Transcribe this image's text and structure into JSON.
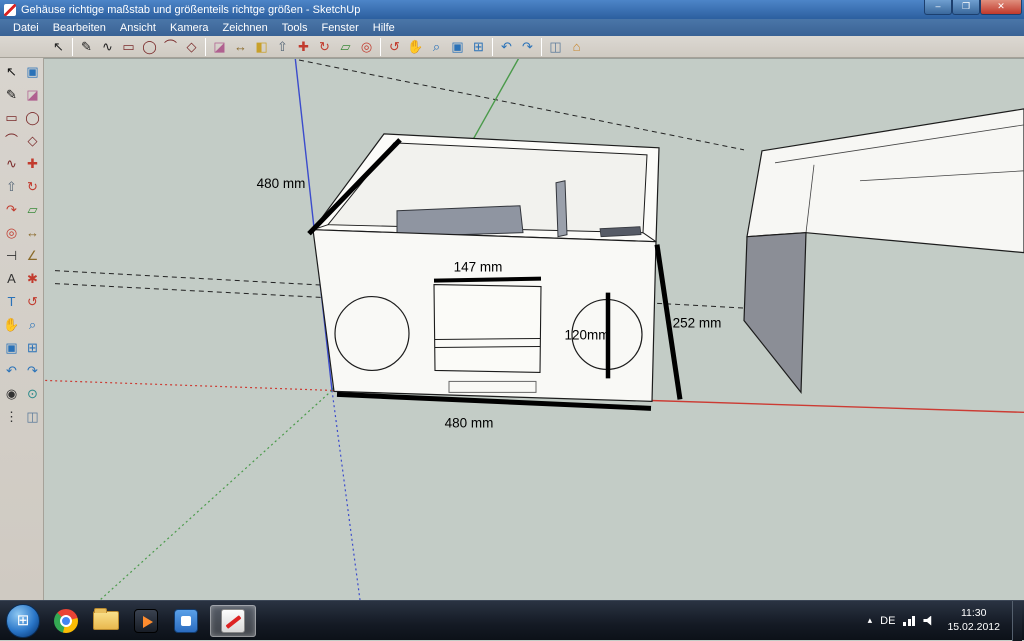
{
  "window": {
    "title": "Gehäuse richtige maßstab und größenteils richtge größen - SketchUp",
    "minimize": "–",
    "maximize": "❐",
    "close": "✕"
  },
  "menubar": {
    "items": [
      "Datei",
      "Bearbeiten",
      "Ansicht",
      "Kamera",
      "Zeichnen",
      "Tools",
      "Fenster",
      "Hilfe"
    ]
  },
  "toolbar": {
    "tools": [
      {
        "name": "select",
        "glyph": "↖",
        "color": "#222222"
      },
      {
        "name": "line",
        "glyph": "✎",
        "color": "#222222"
      },
      {
        "name": "freehand",
        "glyph": "∿",
        "color": "#222222"
      },
      {
        "name": "rectangle",
        "glyph": "▭",
        "color": "#7a2a2a"
      },
      {
        "name": "circle",
        "glyph": "◯",
        "color": "#7a2a2a"
      },
      {
        "name": "arc",
        "glyph": "⌒",
        "color": "#7a2a2a"
      },
      {
        "name": "polygon",
        "glyph": "◇",
        "color": "#7a2a2a"
      },
      {
        "name": "eraser",
        "glyph": "◪",
        "color": "#b06090"
      },
      {
        "name": "tape-measure",
        "glyph": "↔",
        "color": "#8a6a2a"
      },
      {
        "name": "paint-bucket",
        "glyph": "◧",
        "color": "#c8a02a"
      },
      {
        "name": "push-pull",
        "glyph": "⇧",
        "color": "#556677"
      },
      {
        "name": "move",
        "glyph": "✚",
        "color": "#c23b2e"
      },
      {
        "name": "rotate",
        "glyph": "↻",
        "color": "#c23b2e"
      },
      {
        "name": "scale",
        "glyph": "▱",
        "color": "#3a8a3a"
      },
      {
        "name": "offset",
        "glyph": "◎",
        "color": "#c23b2e"
      },
      {
        "name": "orbit",
        "glyph": "↺",
        "color": "#c23b2e"
      },
      {
        "name": "pan",
        "glyph": "✋",
        "color": "#b8863a"
      },
      {
        "name": "zoom",
        "glyph": "⌕",
        "color": "#2a72b8"
      },
      {
        "name": "zoom-window",
        "glyph": "▣",
        "color": "#2a72b8"
      },
      {
        "name": "zoom-extents",
        "glyph": "⊞",
        "color": "#2a72b8"
      },
      {
        "name": "previous",
        "glyph": "↶",
        "color": "#2a72b8"
      },
      {
        "name": "next",
        "glyph": "↷",
        "color": "#2a72b8"
      },
      {
        "name": "section-plane",
        "glyph": "◫",
        "color": "#5a7a9a"
      },
      {
        "name": "get-models",
        "glyph": "⌂",
        "color": "#c8862a"
      }
    ]
  },
  "palette": {
    "tools": [
      {
        "name": "select",
        "glyph": "↖",
        "color": "#111111"
      },
      {
        "name": "make-component",
        "glyph": "▣",
        "color": "#2a72b8"
      },
      {
        "name": "line",
        "glyph": "✎",
        "color": "#111111"
      },
      {
        "name": "eraser",
        "glyph": "◪",
        "color": "#b06090"
      },
      {
        "name": "rectangle",
        "glyph": "▭",
        "color": "#7a2a2a"
      },
      {
        "name": "circle",
        "glyph": "◯",
        "color": "#7a2a2a"
      },
      {
        "name": "arc",
        "glyph": "⌒",
        "color": "#7a2a2a"
      },
      {
        "name": "polygon",
        "glyph": "◇",
        "color": "#7a2a2a"
      },
      {
        "name": "freehand",
        "glyph": "∿",
        "color": "#7a2a2a"
      },
      {
        "name": "move",
        "glyph": "✚",
        "color": "#c23b2e"
      },
      {
        "name": "push-pull",
        "glyph": "⇧",
        "color": "#556677"
      },
      {
        "name": "rotate",
        "glyph": "↻",
        "color": "#c23b2e"
      },
      {
        "name": "follow-me",
        "glyph": "↷",
        "color": "#c23b2e"
      },
      {
        "name": "scale",
        "glyph": "▱",
        "color": "#3a8a3a"
      },
      {
        "name": "offset",
        "glyph": "◎",
        "color": "#c23b2e"
      },
      {
        "name": "tape-measure",
        "glyph": "↔",
        "color": "#8a6a2a"
      },
      {
        "name": "dimension",
        "glyph": "⊣",
        "color": "#333333"
      },
      {
        "name": "protractor",
        "glyph": "∠",
        "color": "#8a6a2a"
      },
      {
        "name": "text",
        "glyph": "A",
        "color": "#333333"
      },
      {
        "name": "axes",
        "glyph": "✱",
        "color": "#c23b2e"
      },
      {
        "name": "3d-text",
        "glyph": "T",
        "color": "#2a72b8"
      },
      {
        "name": "orbit",
        "glyph": "↺",
        "color": "#c23b2e"
      },
      {
        "name": "pan",
        "glyph": "✋",
        "color": "#b8863a"
      },
      {
        "name": "zoom",
        "glyph": "⌕",
        "color": "#2a72b8"
      },
      {
        "name": "zoom-window",
        "glyph": "▣",
        "color": "#2a72b8"
      },
      {
        "name": "zoom-extents",
        "glyph": "⊞",
        "color": "#2a72b8"
      },
      {
        "name": "previous",
        "glyph": "↶",
        "color": "#2a72b8"
      },
      {
        "name": "next",
        "glyph": "↷",
        "color": "#2a72b8"
      },
      {
        "name": "position-camera",
        "glyph": "◉",
        "color": "#333333"
      },
      {
        "name": "look-around",
        "glyph": "⊙",
        "color": "#2a8a8a"
      },
      {
        "name": "walk",
        "glyph": "⋮",
        "color": "#333333"
      },
      {
        "name": "section-plane",
        "glyph": "◫",
        "color": "#5a7a9a"
      }
    ]
  },
  "viewport": {
    "dimensions": {
      "edge_top_left": "480 mm",
      "opening_width": "147 mm",
      "circle_height": "120mm",
      "edge_right": "252 mm",
      "edge_bottom": "480 mm"
    }
  },
  "colors": {
    "red_axis": "#cc3b33",
    "green_axis": "#4a9a4a",
    "blue_axis": "#3b4bcc"
  },
  "taskbar": {
    "start_glyph": "⊞",
    "tray": {
      "hidden": "▴",
      "language": "DE",
      "time": "11:30",
      "date": "15.02.2012"
    }
  }
}
